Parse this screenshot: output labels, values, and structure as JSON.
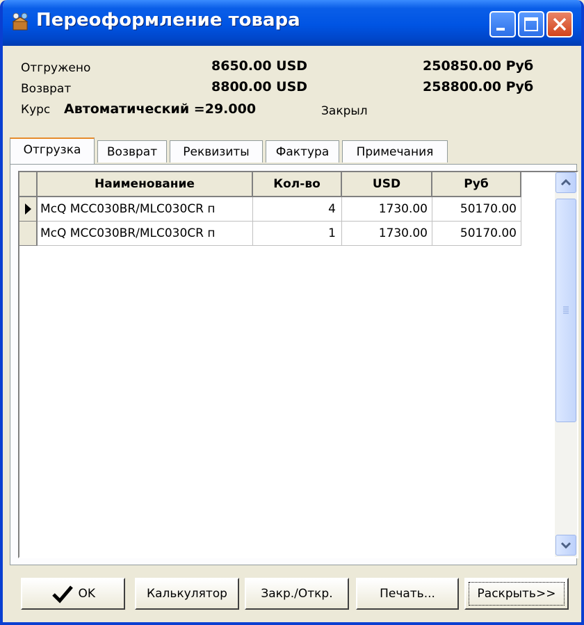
{
  "window": {
    "title": "Переоформление товара",
    "accent": "#0054e3",
    "icons": [
      "app-icon",
      "minimize-icon",
      "maximize-icon",
      "close-icon"
    ]
  },
  "info": {
    "shipped_label": "Отгружено",
    "shipped_usd": "8650.00  USD",
    "shipped_rub": "250850.00  Руб",
    "return_label": "Возврат",
    "return_usd": "8800.00  USD",
    "return_rub": "258800.00  Руб",
    "rate_label": "Курс",
    "rate_value": "Автоматический =29.000",
    "status": "Закрыл"
  },
  "tabs": [
    {
      "label": "Отгрузка",
      "active": true
    },
    {
      "label": "Возврат"
    },
    {
      "label": "Реквизиты"
    },
    {
      "label": "Фактура"
    },
    {
      "label": "Примечания"
    }
  ],
  "table": {
    "columns": [
      "Наименование",
      "Кол-во",
      "USD",
      "Руб"
    ],
    "rows": [
      [
        "McQ MCC030BR/MLC030CR п",
        "4",
        "1730.00",
        "50170.00"
      ],
      [
        "McQ MCC030BR/MLC030CR п",
        "1",
        "1730.00",
        "50170.00"
      ]
    ],
    "current_row": 0
  },
  "buttons": {
    "ok": "OK",
    "calculator": "Калькулятор",
    "close_open": "Закр./Откр.",
    "print": "Печать...",
    "expand": "Раскрыть>>"
  }
}
